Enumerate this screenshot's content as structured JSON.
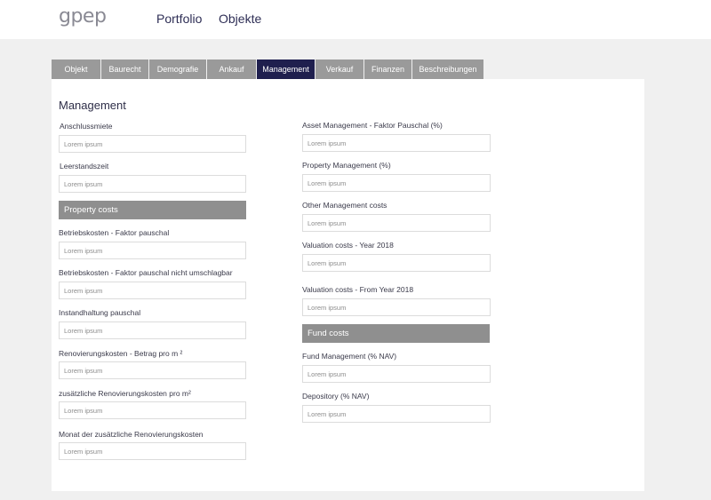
{
  "header": {
    "logo": "gpep",
    "nav": [
      "Portfolio",
      "Objekte"
    ]
  },
  "tabs": [
    "Objekt",
    "Baurecht",
    "Demografie",
    "Ankauf",
    "Management",
    "Verkauf",
    "Finanzen",
    "Beschreibungen"
  ],
  "active_tab": "Management",
  "page_title": "Management",
  "placeholder": "Lorem ipsum",
  "left": {
    "fields": [
      "Anschlussmiete",
      "Leerstandszeit"
    ],
    "section_property": "Property costs",
    "property_fields": [
      "Betriebskosten - Faktor pauschal",
      "Betriebskosten - Faktor pauschal nicht umschlagbar",
      "Instandhaltung pauschal",
      "Renovierungskosten - Betrag pro m ²",
      "zusätzliche Renovierungskosten  pro m²",
      "Monat der zusätzliche Renovierungskosten"
    ]
  },
  "right": {
    "fields": [
      "Asset Management - Faktor Pauschal (%)",
      "Property Management (%)",
      "Other Management costs",
      "Valuation costs - Year 2018",
      "Valuation costs - From Year 2018"
    ],
    "section_fund": "Fund costs",
    "fund_fields": [
      "Fund Management (% NAV)",
      "Depository (% NAV)"
    ]
  },
  "colors": {
    "active_tab": "#1f1f4e",
    "tab": "#9a9a9a",
    "section_bar": "#8f8f8f",
    "background": "#f0f0f0"
  }
}
